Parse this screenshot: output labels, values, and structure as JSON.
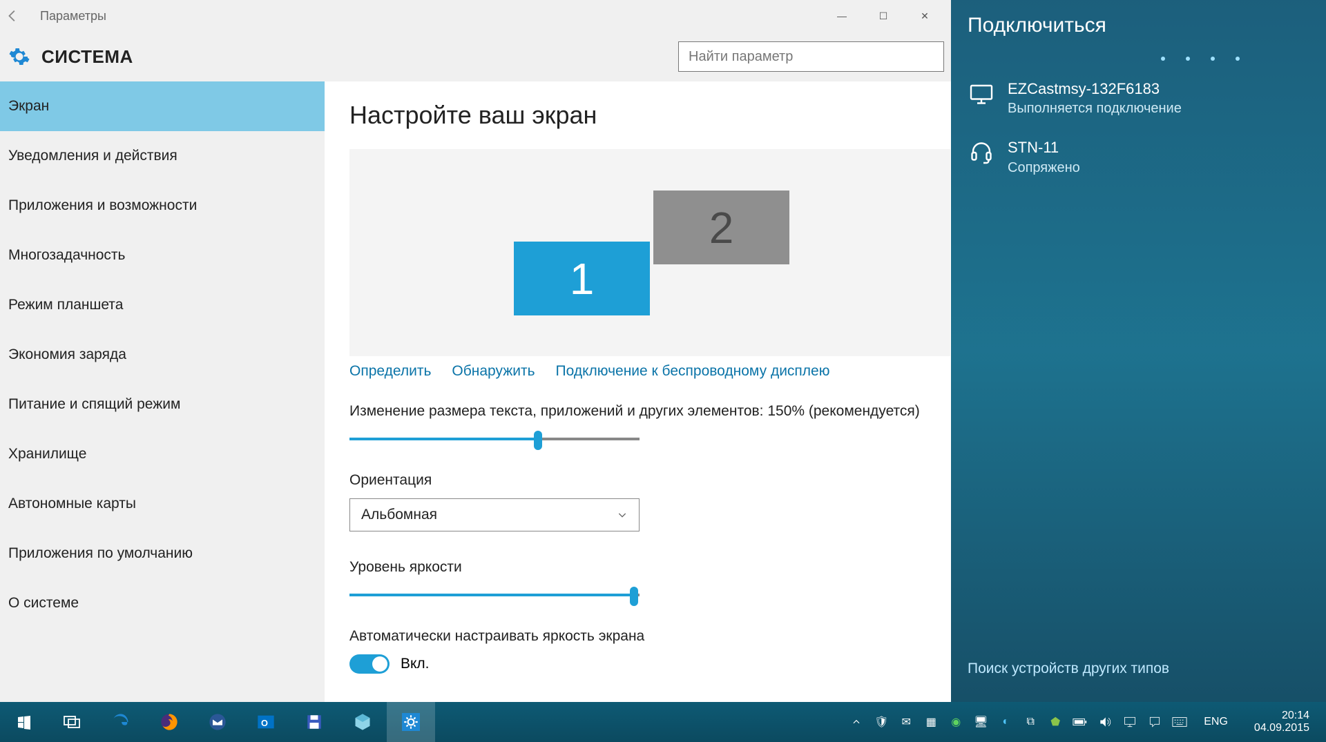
{
  "window": {
    "title": "Параметры",
    "header": "СИСТЕМА",
    "search_placeholder": "Найти параметр"
  },
  "sidebar": {
    "items": [
      {
        "label": "Экран",
        "selected": true
      },
      {
        "label": "Уведомления и действия"
      },
      {
        "label": "Приложения и возможности"
      },
      {
        "label": "Многозадачность"
      },
      {
        "label": "Режим планшета"
      },
      {
        "label": "Экономия заряда"
      },
      {
        "label": "Питание и спящий режим"
      },
      {
        "label": "Хранилище"
      },
      {
        "label": "Автономные карты"
      },
      {
        "label": "Приложения по умолчанию"
      },
      {
        "label": "О системе"
      }
    ]
  },
  "content": {
    "heading": "Настройте ваш экран",
    "monitors": [
      {
        "id": "1",
        "primary": true
      },
      {
        "id": "2",
        "primary": false
      }
    ],
    "links": {
      "identify": "Определить",
      "detect": "Обнаружить",
      "wireless": "Подключение к беспроводному дисплею"
    },
    "scale_label": "Изменение размера текста, приложений и других элементов: 150% (рекомендуется)",
    "scale_percent": 65,
    "orientation_label": "Ориентация",
    "orientation_value": "Альбомная",
    "brightness_label": "Уровень яркости",
    "brightness_percent": 98,
    "auto_brightness_label": "Автоматически настраивать яркость экрана",
    "auto_brightness_state": "Вкл."
  },
  "connect": {
    "title": "Подключиться",
    "devices": [
      {
        "icon": "monitor",
        "name": "EZCastmsy-132F6183",
        "status": "Выполняется подключение"
      },
      {
        "icon": "headset",
        "name": "STN-11",
        "status": "Сопряжено"
      }
    ],
    "other_link": "Поиск устройств других типов"
  },
  "taskbar": {
    "apps": [
      {
        "name": "start-button",
        "icon": "windows"
      },
      {
        "name": "task-view-button",
        "icon": "taskview"
      },
      {
        "name": "edge-app",
        "icon": "edge"
      },
      {
        "name": "firefox-app",
        "icon": "firefox"
      },
      {
        "name": "thunderbird-app",
        "icon": "thunderbird"
      },
      {
        "name": "outlook-app",
        "icon": "outlook"
      },
      {
        "name": "save-app",
        "icon": "floppy"
      },
      {
        "name": "box-app",
        "icon": "box"
      },
      {
        "name": "settings-app",
        "icon": "gear",
        "active": true
      }
    ],
    "tray": [
      {
        "name": "tray-chevron-icon"
      },
      {
        "name": "tray-security-icon"
      },
      {
        "name": "tray-mail-icon"
      },
      {
        "name": "tray-app1-icon"
      },
      {
        "name": "tray-app2-icon"
      },
      {
        "name": "tray-monitor-icon"
      },
      {
        "name": "tray-sync-icon"
      },
      {
        "name": "tray-dropbox-icon"
      },
      {
        "name": "tray-shield-icon"
      },
      {
        "name": "tray-battery-icon"
      },
      {
        "name": "tray-volume-icon"
      },
      {
        "name": "tray-network-icon"
      },
      {
        "name": "tray-action-center-icon"
      },
      {
        "name": "tray-keyboard-icon"
      }
    ],
    "lang": "ENG",
    "time": "20:14",
    "date": "04.09.2015"
  }
}
